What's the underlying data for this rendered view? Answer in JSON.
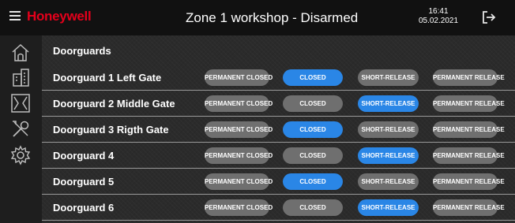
{
  "header": {
    "logo": "Honeywell",
    "title": "Zone 1 workshop - Disarmed",
    "time": "16:41",
    "date": "05.02.2021"
  },
  "sidebar": {
    "items": [
      {
        "icon": "home-icon"
      },
      {
        "icon": "building-icon"
      },
      {
        "icon": "door-icon"
      },
      {
        "icon": "tools-icon"
      },
      {
        "icon": "gear-icon"
      }
    ]
  },
  "main": {
    "section_title": "Doorguards",
    "button_labels": [
      "PERMANENT CLOSED",
      "CLOSED",
      "SHORT-RELEASE",
      "PERMANENT RELEASE"
    ],
    "rows": [
      {
        "name": "Doorguard 1 Left Gate",
        "active": "CLOSED"
      },
      {
        "name": "Doorguard 2 Middle Gate",
        "active": "SHORT-RELEASE"
      },
      {
        "name": "Doorguard 3 Rigth Gate",
        "active": "CLOSED"
      },
      {
        "name": "Doorguard 4",
        "active": "SHORT-RELEASE"
      },
      {
        "name": "Doorguard 5",
        "active": "CLOSED"
      },
      {
        "name": "Doorguard 6",
        "active": "SHORT-RELEASE"
      }
    ]
  },
  "colors": {
    "accent": "#2a86e6",
    "button": "#6f6f6f",
    "brand": "#e4001b",
    "background": "#2b2b2b"
  }
}
